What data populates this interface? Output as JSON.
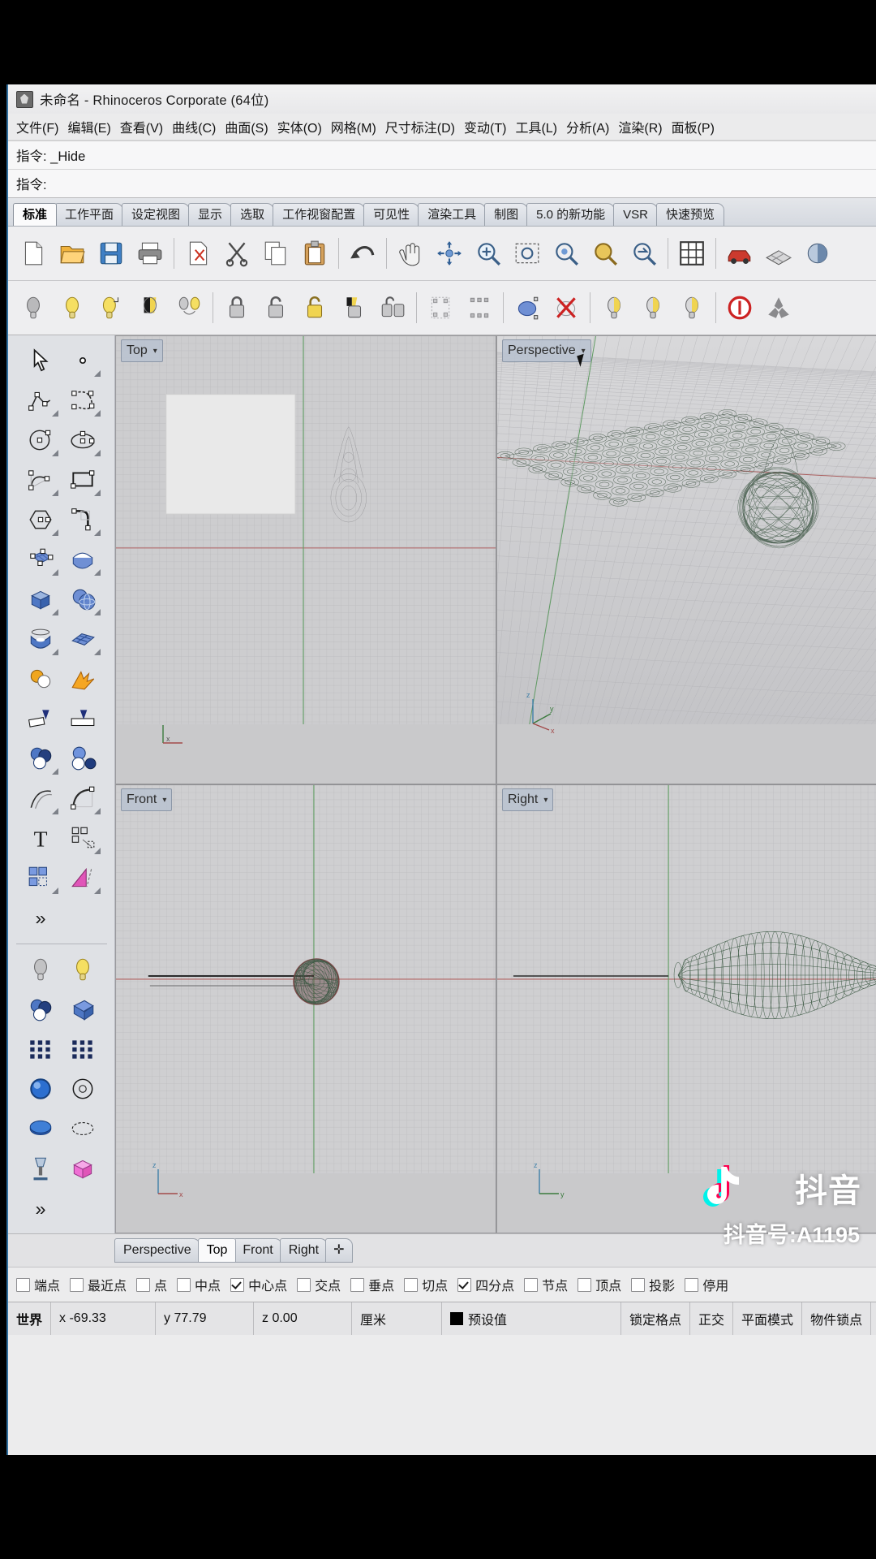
{
  "window": {
    "title": "未命名 - Rhinoceros Corporate (64位)",
    "app_icon": "rhino-icon"
  },
  "menubar": {
    "items": [
      {
        "label": "文件(F)",
        "name": "menu-file"
      },
      {
        "label": "编辑(E)",
        "name": "menu-edit"
      },
      {
        "label": "查看(V)",
        "name": "menu-view"
      },
      {
        "label": "曲线(C)",
        "name": "menu-curve"
      },
      {
        "label": "曲面(S)",
        "name": "menu-surface"
      },
      {
        "label": "实体(O)",
        "name": "menu-solid"
      },
      {
        "label": "网格(M)",
        "name": "menu-mesh"
      },
      {
        "label": "尺寸标注(D)",
        "name": "menu-dimension"
      },
      {
        "label": "变动(T)",
        "name": "menu-transform"
      },
      {
        "label": "工具(L)",
        "name": "menu-tools"
      },
      {
        "label": "分析(A)",
        "name": "menu-analyze"
      },
      {
        "label": "渲染(R)",
        "name": "menu-render"
      },
      {
        "label": "面板(P)",
        "name": "menu-panels"
      }
    ]
  },
  "command": {
    "line1": "指令: _Hide",
    "line2": "指令:"
  },
  "toolbar_tabs": [
    {
      "label": "标准",
      "active": true
    },
    {
      "label": "工作平面",
      "active": false
    },
    {
      "label": "设定视图",
      "active": false
    },
    {
      "label": "显示",
      "active": false
    },
    {
      "label": "选取",
      "active": false
    },
    {
      "label": "工作视窗配置",
      "active": false
    },
    {
      "label": "可见性",
      "active": false
    },
    {
      "label": "渲染工具",
      "active": false
    },
    {
      "label": "制图",
      "active": false
    },
    {
      "label": "5.0 的新功能",
      "active": false
    },
    {
      "label": "VSR",
      "active": false
    },
    {
      "label": "快速预览",
      "active": false
    }
  ],
  "standard_toolbar": [
    {
      "name": "new-file-icon"
    },
    {
      "name": "open-file-icon"
    },
    {
      "name": "save-file-icon"
    },
    {
      "name": "print-icon"
    },
    {
      "name": "cut-plane-icon"
    },
    {
      "name": "cut-icon"
    },
    {
      "name": "copy-icon"
    },
    {
      "name": "paste-icon"
    },
    {
      "name": "undo-icon"
    },
    {
      "name": "pan-hand-icon"
    },
    {
      "name": "rotate-view-icon"
    },
    {
      "name": "zoom-window-icon"
    },
    {
      "name": "zoom-extents-icon"
    },
    {
      "name": "zoom-selected-icon"
    },
    {
      "name": "zoom-target-icon"
    },
    {
      "name": "zoom-previous-icon"
    },
    {
      "name": "grid-snap-icon"
    },
    {
      "name": "render-car-icon"
    },
    {
      "name": "render-mesh-icon"
    },
    {
      "name": "shade-icon"
    }
  ],
  "visibility_toolbar": [
    {
      "name": "hide-objects-icon"
    },
    {
      "name": "show-objects-icon"
    },
    {
      "name": "show-selected-icon"
    },
    {
      "name": "swap-hidden-icon"
    },
    {
      "name": "hide-swap-icon"
    },
    {
      "name": "lock-objects-icon"
    },
    {
      "name": "unlock-objects-icon"
    },
    {
      "name": "unlock-selected-icon"
    },
    {
      "name": "lock-swap-icon"
    },
    {
      "name": "lock-toggle-icon"
    },
    {
      "name": "select-points-off-icon"
    },
    {
      "name": "select-points-on-icon"
    },
    {
      "name": "control-points-on-icon"
    },
    {
      "name": "control-points-off-icon"
    },
    {
      "name": "isolate-icon"
    },
    {
      "name": "unisolate-icon"
    },
    {
      "name": "show-all-icon"
    },
    {
      "name": "abort-icon"
    },
    {
      "name": "rhino-tools-icon"
    }
  ],
  "left_toolbar": [
    {
      "name": "select-arrow-icon",
      "flyout": false
    },
    {
      "name": "point-icon",
      "flyout": true
    },
    {
      "name": "polyline-icon",
      "flyout": true
    },
    {
      "name": "control-point-curve-icon",
      "flyout": true
    },
    {
      "name": "circle-icon",
      "flyout": true
    },
    {
      "name": "ellipse-icon",
      "flyout": true
    },
    {
      "name": "arc-icon",
      "flyout": true
    },
    {
      "name": "rectangle-icon",
      "flyout": true
    },
    {
      "name": "polygon-icon",
      "flyout": true
    },
    {
      "name": "fillet-curve-icon",
      "flyout": true
    },
    {
      "name": "surface-from-points-icon",
      "flyout": true
    },
    {
      "name": "extrude-surface-icon",
      "flyout": true
    },
    {
      "name": "box-solid-icon",
      "flyout": true
    },
    {
      "name": "sphere-solid-icon",
      "flyout": true
    },
    {
      "name": "revolve-surface-icon",
      "flyout": true
    },
    {
      "name": "patch-surface-icon",
      "flyout": true
    },
    {
      "name": "boolean-union-icon",
      "flyout": false
    },
    {
      "name": "explode-icon",
      "flyout": false
    },
    {
      "name": "trim-icon",
      "flyout": false
    },
    {
      "name": "split-icon",
      "flyout": false
    },
    {
      "name": "boolean-ops-icon",
      "flyout": true
    },
    {
      "name": "boolean-difference-icon",
      "flyout": false
    },
    {
      "name": "offset-curve-icon",
      "flyout": true
    },
    {
      "name": "fillet-edge-icon",
      "flyout": true
    },
    {
      "name": "text-icon",
      "flyout": false
    },
    {
      "name": "array-icon",
      "flyout": true
    },
    {
      "name": "block-icon",
      "flyout": true
    },
    {
      "name": "mirror-icon",
      "flyout": true
    },
    {
      "name": "more-tools-icon",
      "flyout": false
    }
  ],
  "left_toolbar_lower": [
    {
      "name": "light-gray-icon"
    },
    {
      "name": "light-yellow-icon"
    },
    {
      "name": "render-spheres-icon"
    },
    {
      "name": "render-mesh-plane-icon"
    },
    {
      "name": "dot-grid-icon"
    },
    {
      "name": "dot-grid-2-icon"
    },
    {
      "name": "shaded-sphere-icon"
    },
    {
      "name": "ghosted-sphere-icon"
    },
    {
      "name": "rendered-disc-icon"
    },
    {
      "name": "wire-disc-icon"
    },
    {
      "name": "lamp-icon"
    },
    {
      "name": "pink-box-icon"
    },
    {
      "name": "more-tools-icon"
    }
  ],
  "viewports": [
    {
      "label": "Top",
      "name": "viewport-top",
      "position": "top-left"
    },
    {
      "label": "Perspective",
      "name": "viewport-perspective",
      "position": "top-right"
    },
    {
      "label": "Front",
      "name": "viewport-front",
      "position": "bottom-left"
    },
    {
      "label": "Right",
      "name": "viewport-right",
      "position": "bottom-right"
    }
  ],
  "viewport_tabs": [
    {
      "label": "Perspective",
      "active": false
    },
    {
      "label": "Top",
      "active": true
    },
    {
      "label": "Front",
      "active": false
    },
    {
      "label": "Right",
      "active": false
    },
    {
      "label": "✛",
      "active": false
    }
  ],
  "osnap": [
    {
      "label": "端点",
      "checked": false
    },
    {
      "label": "最近点",
      "checked": false
    },
    {
      "label": "点",
      "checked": false
    },
    {
      "label": "中点",
      "checked": false
    },
    {
      "label": "中心点",
      "checked": true
    },
    {
      "label": "交点",
      "checked": false
    },
    {
      "label": "垂点",
      "checked": false
    },
    {
      "label": "切点",
      "checked": false
    },
    {
      "label": "四分点",
      "checked": true
    },
    {
      "label": "节点",
      "checked": false
    },
    {
      "label": "顶点",
      "checked": false
    },
    {
      "label": "投影",
      "checked": false
    },
    {
      "label": "停用",
      "checked": false
    }
  ],
  "statusbar": {
    "cplane": "世界",
    "x": "x -69.33",
    "y": "y 77.79",
    "z": "z 0.00",
    "units": "厘米",
    "layer": "预设值",
    "layer_color": "#000000",
    "toggles": [
      "锁定格点",
      "正交",
      "平面模式",
      "物件锁点"
    ]
  },
  "watermark": {
    "brand": "抖音",
    "id": "抖音号:A1195",
    "logo": "douyin-logo-icon"
  }
}
